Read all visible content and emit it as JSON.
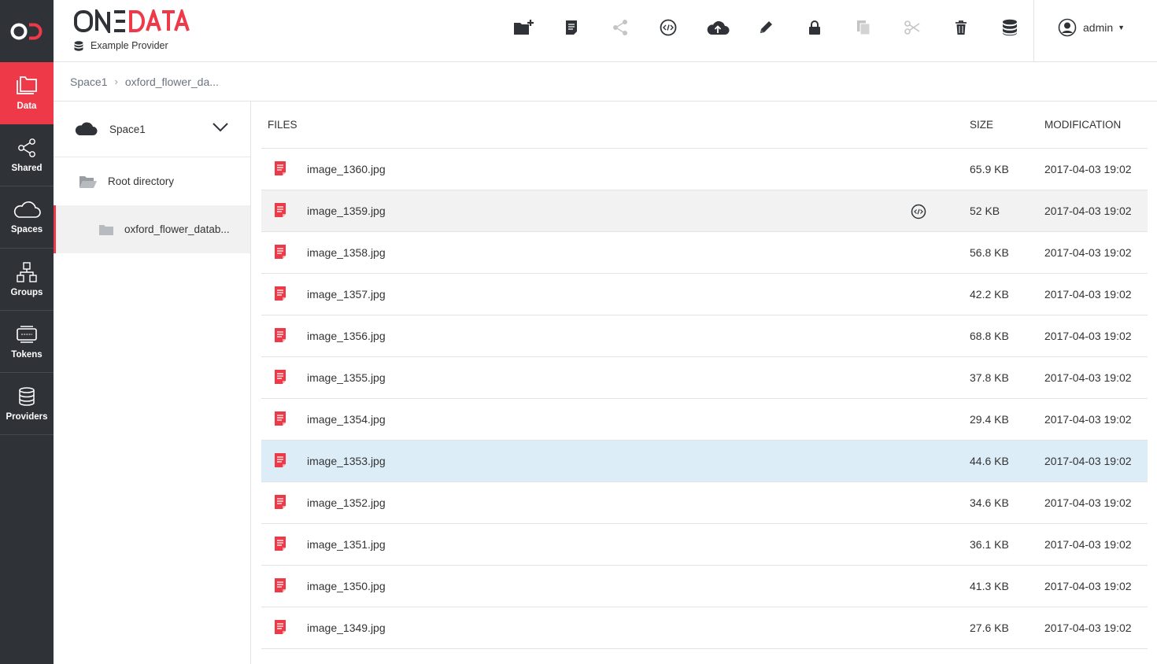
{
  "app": {
    "logo_text": "ONEDATA",
    "provider_name": "Example Provider",
    "accent_color": "#ee3a48",
    "nav_bg": "#2f3338"
  },
  "nav": {
    "items": [
      {
        "label": "Data",
        "icon": "folders-icon",
        "active": true
      },
      {
        "label": "Shared",
        "icon": "share-icon",
        "active": false
      },
      {
        "label": "Spaces",
        "icon": "cloud-icon",
        "active": false
      },
      {
        "label": "Groups",
        "icon": "groups-icon",
        "active": false
      },
      {
        "label": "Tokens",
        "icon": "token-icon",
        "active": false
      },
      {
        "label": "Providers",
        "icon": "database-icon",
        "active": false
      }
    ]
  },
  "toolbar": {
    "buttons": [
      {
        "name": "new-directory",
        "icon": "folder-plus-icon",
        "enabled": true
      },
      {
        "name": "new-file",
        "icon": "file-icon",
        "enabled": true
      },
      {
        "name": "share",
        "icon": "share-icon",
        "enabled": false
      },
      {
        "name": "metadata",
        "icon": "code-icon",
        "enabled": true
      },
      {
        "name": "upload",
        "icon": "cloud-upload-icon",
        "enabled": true
      },
      {
        "name": "rename",
        "icon": "pencil-icon",
        "enabled": true
      },
      {
        "name": "permissions",
        "icon": "lock-icon",
        "enabled": true
      },
      {
        "name": "copy",
        "icon": "copy-icon",
        "enabled": false
      },
      {
        "name": "cut",
        "icon": "scissors-icon",
        "enabled": false
      },
      {
        "name": "delete",
        "icon": "trash-icon",
        "enabled": true
      },
      {
        "name": "distribution",
        "icon": "database-icon",
        "enabled": true
      }
    ]
  },
  "user": {
    "name": "admin"
  },
  "breadcrumb": {
    "items": [
      "Space1",
      "oxford_flower_da..."
    ]
  },
  "tree": {
    "space_name": "Space1",
    "root_label": "Root directory",
    "sub_label": "oxford_flower_datab..."
  },
  "files": {
    "headers": {
      "name": "FILES",
      "size": "SIZE",
      "modification": "MODIFICATION"
    },
    "rows": [
      {
        "name": "image_1360.jpg",
        "size": "65.9 KB",
        "modified": "2017-04-03 19:02",
        "state": "normal"
      },
      {
        "name": "image_1359.jpg",
        "size": "52 KB",
        "modified": "2017-04-03 19:02",
        "state": "hover",
        "has_metadata": true
      },
      {
        "name": "image_1358.jpg",
        "size": "56.8 KB",
        "modified": "2017-04-03 19:02",
        "state": "normal"
      },
      {
        "name": "image_1357.jpg",
        "size": "42.2 KB",
        "modified": "2017-04-03 19:02",
        "state": "normal"
      },
      {
        "name": "image_1356.jpg",
        "size": "68.8 KB",
        "modified": "2017-04-03 19:02",
        "state": "normal"
      },
      {
        "name": "image_1355.jpg",
        "size": "37.8 KB",
        "modified": "2017-04-03 19:02",
        "state": "normal"
      },
      {
        "name": "image_1354.jpg",
        "size": "29.4 KB",
        "modified": "2017-04-03 19:02",
        "state": "normal"
      },
      {
        "name": "image_1353.jpg",
        "size": "44.6 KB",
        "modified": "2017-04-03 19:02",
        "state": "selected"
      },
      {
        "name": "image_1352.jpg",
        "size": "34.6 KB",
        "modified": "2017-04-03 19:02",
        "state": "normal"
      },
      {
        "name": "image_1351.jpg",
        "size": "36.1 KB",
        "modified": "2017-04-03 19:02",
        "state": "normal"
      },
      {
        "name": "image_1350.jpg",
        "size": "41.3 KB",
        "modified": "2017-04-03 19:02",
        "state": "normal"
      },
      {
        "name": "image_1349.jpg",
        "size": "27.6 KB",
        "modified": "2017-04-03 19:02",
        "state": "normal"
      }
    ]
  }
}
